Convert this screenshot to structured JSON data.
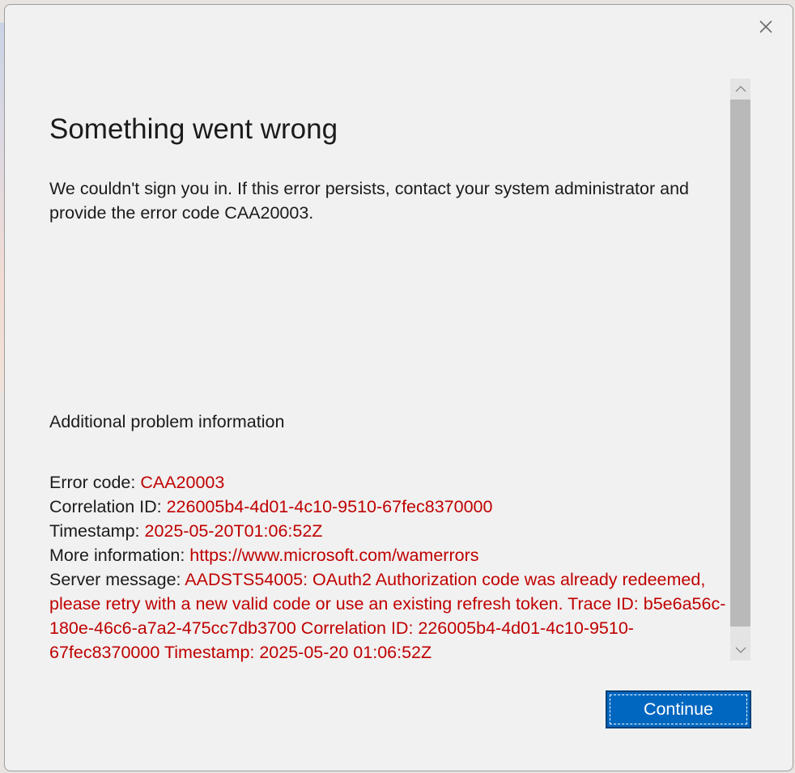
{
  "dialog": {
    "title": "Something went wrong",
    "message": "We couldn't sign you in. If this error persists, contact your system administrator and provide the error code CAA20003.",
    "additional_heading": "Additional problem information",
    "details": {
      "error_code_label": "Error code: ",
      "error_code_value": "CAA20003",
      "correlation_id_label": "Correlation ID: ",
      "correlation_id_value": "226005b4-4d01-4c10-9510-67fec8370000",
      "timestamp_label": "Timestamp: ",
      "timestamp_value": "2025-05-20T01:06:52Z",
      "more_info_label": "More information: ",
      "more_info_value": "https://www.microsoft.com/wamerrors",
      "server_message_label": "Server message: ",
      "server_message_value": "AADSTS54005: OAuth2 Authorization code was already redeemed, please retry with a new valid code or use an existing refresh token. Trace ID: b5e6a56c-180e-46c6-a7a2-475cc7db3700 Correlation ID: 226005b4-4d01-4c10-9510-67fec8370000 Timestamp: 2025-05-20 01:06:52Z"
    },
    "continue_label": "Continue"
  },
  "icons": {
    "close": "close-icon",
    "scroll_up": "chevron-up-icon",
    "scroll_down": "chevron-down-icon"
  },
  "colors": {
    "error_value": "#c00000",
    "primary_button": "#0067c0",
    "background": "#f1f1f1"
  }
}
